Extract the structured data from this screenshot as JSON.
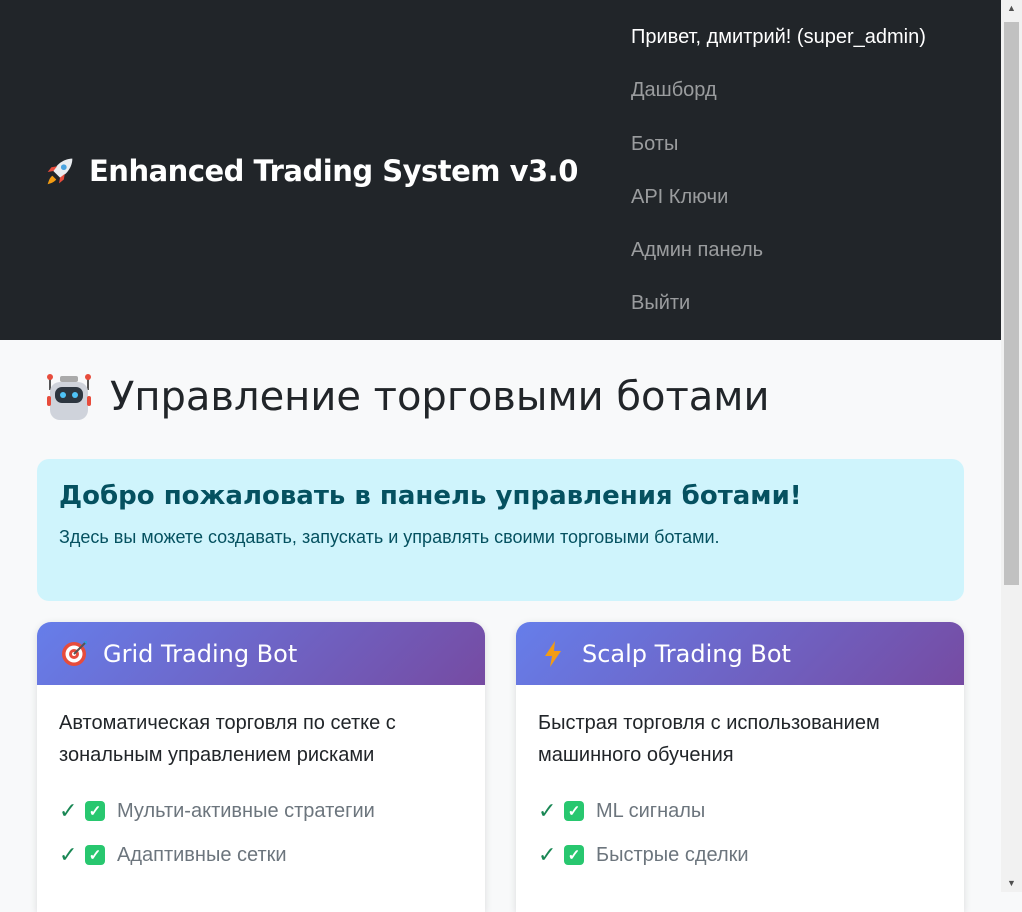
{
  "navbar": {
    "brand_icon": "rocket-icon",
    "brand": "Enhanced Trading System v3.0",
    "greeting": "Привет, дмитрий! (super_admin)",
    "links": [
      "Дашборд",
      "Боты",
      "API Ключи",
      "Админ панель",
      "Выйти"
    ]
  },
  "page": {
    "title_icon": "robot-icon",
    "title": "Управление торговыми ботами"
  },
  "alert": {
    "heading": "Добро пожаловать в панель управления ботами!",
    "text": "Здесь вы можете создавать, запускать и управлять своими торговыми ботами."
  },
  "cards": [
    {
      "icon": "target-icon",
      "title": "Grid Trading Bot",
      "description": "Автоматическая торговля по сетке с зональным управлением рисками",
      "features": [
        "Мульти-активные стратегии",
        "Адаптивные сетки"
      ]
    },
    {
      "icon": "lightning-icon",
      "title": "Scalp Trading Bot",
      "description": "Быстрая торговля с использованием машинного обучения",
      "features": [
        "ML сигналы",
        "Быстрые сделки"
      ]
    }
  ],
  "colors": {
    "navbar_bg": "#212529",
    "alert_bg": "#cff4fc",
    "alert_text": "#055160",
    "card_header_start": "#667eea",
    "card_header_end": "#764ba2",
    "check_green": "#198754"
  }
}
